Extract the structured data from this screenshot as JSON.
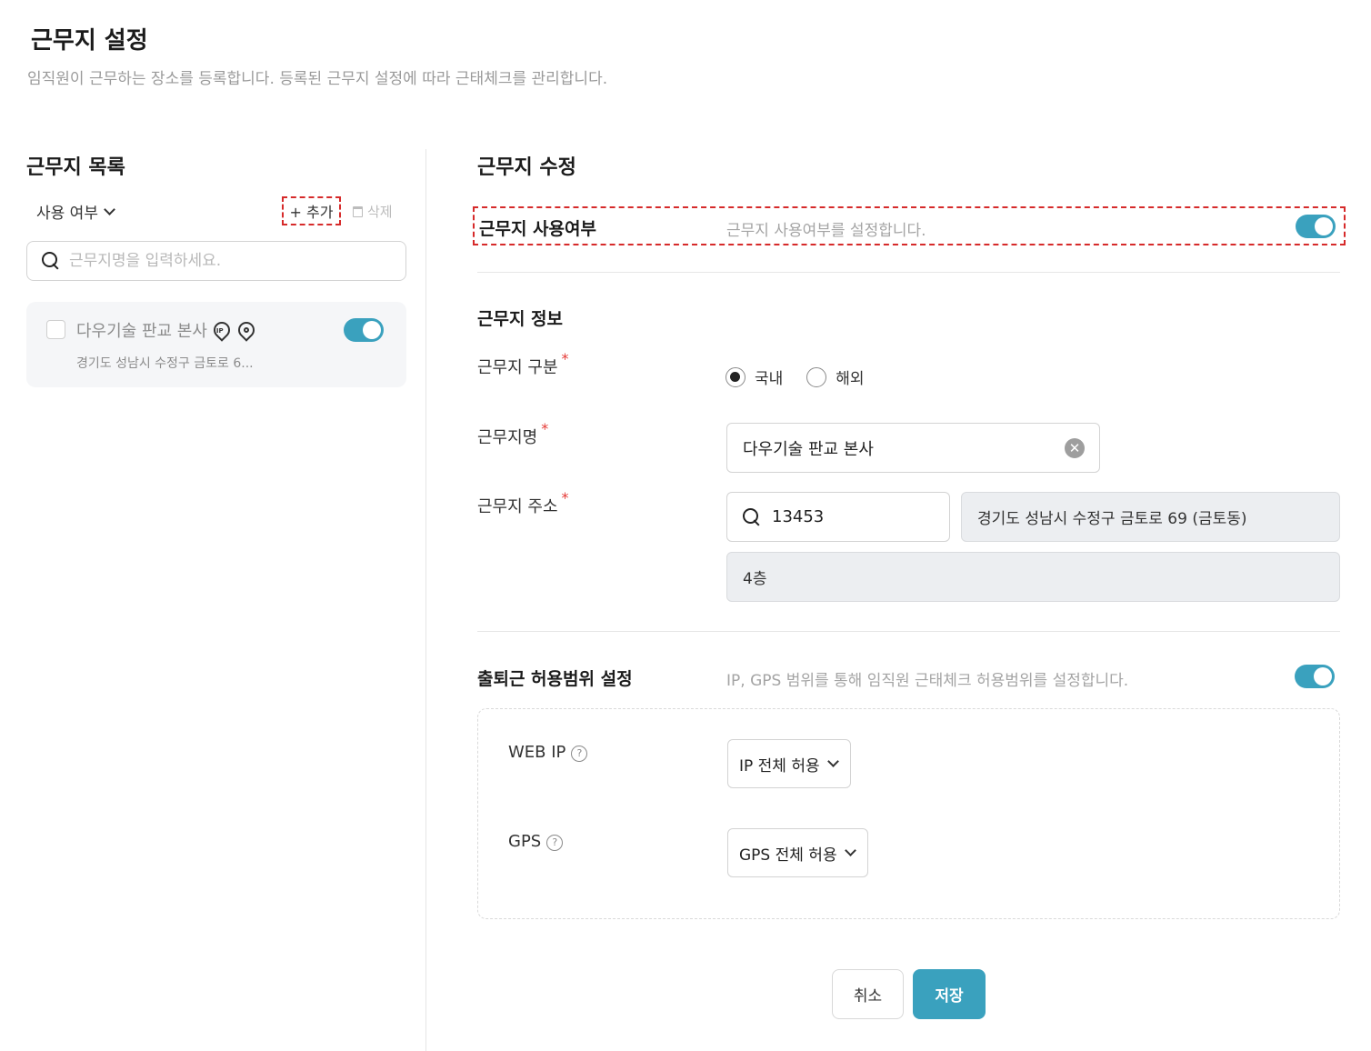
{
  "page": {
    "title": "근무지 설정",
    "description": "임직원이 근무하는 장소를 등록합니다. 등록된 근무지 설정에 따라 근태체크를 관리합니다."
  },
  "list": {
    "title": "근무지 목록",
    "filter_label": "사용 여부",
    "add_label": "+ 추가",
    "delete_label": "삭제",
    "search_placeholder": "근무지명을 입력하세요.",
    "items": [
      {
        "name": "다우기술 판교 본사",
        "address": "경기도 성남시 수정구 금토로 6...",
        "enabled": true
      }
    ]
  },
  "edit": {
    "title": "근무지 수정",
    "usage_label": "근무지 사용여부",
    "usage_desc": "근무지 사용여부를 설정합니다.",
    "usage_enabled": true,
    "info_title": "근무지 정보",
    "type_label": "근무지 구분",
    "type_options": [
      "국내",
      "해외"
    ],
    "type_selected": "국내",
    "required_mark": "*",
    "name_label": "근무지명",
    "name_value": "다우기술 판교 본사",
    "address_label": "근무지 주소",
    "zip_value": "13453",
    "address_value": "경기도 성남시 수정구 금토로 69 (금토동)",
    "address_detail": "4층",
    "range_label": "출퇴근 허용범위 설정",
    "range_desc": "IP, GPS 범위를 통해 임직원 근태체크 허용범위를 설정합니다.",
    "range_enabled": true,
    "web_ip_label": "WEB IP",
    "web_ip_value": "IP 전체 허용",
    "gps_label": "GPS",
    "gps_value": "GPS 전체 허용",
    "help_glyph": "?",
    "clear_glyph": "✕",
    "ip_glyph": "IP"
  },
  "actions": {
    "cancel": "취소",
    "save": "저장"
  },
  "colors": {
    "accent": "#3aa1be",
    "highlight_border": "#d62a2a",
    "required": "#e53935"
  }
}
